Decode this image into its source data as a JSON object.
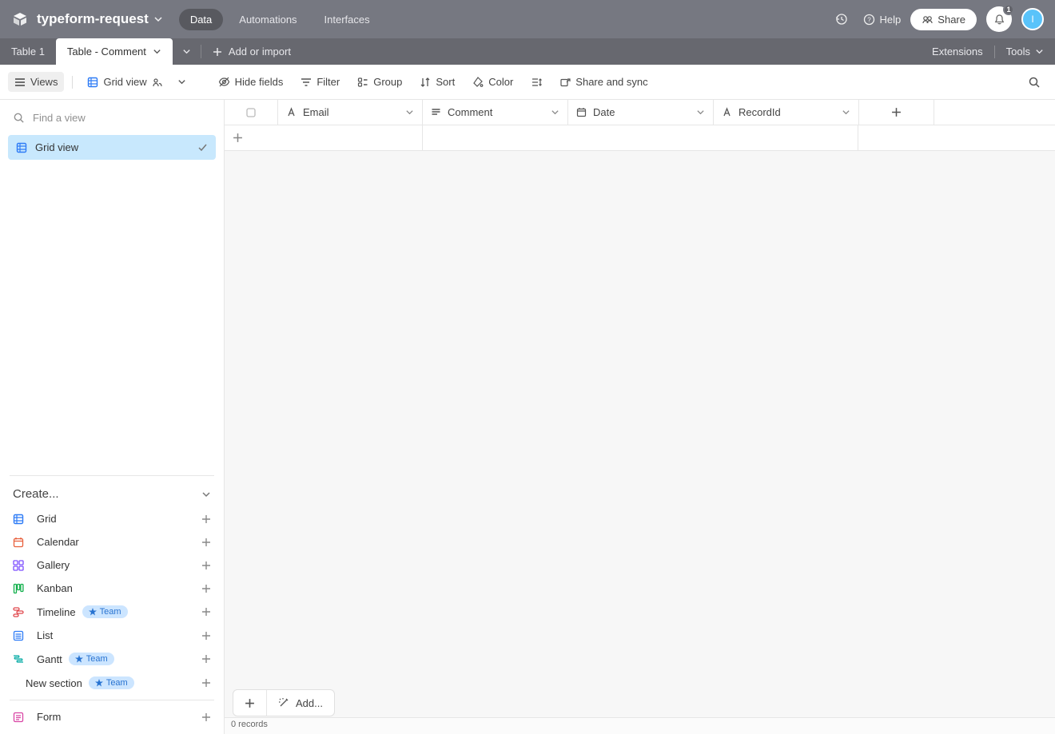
{
  "topbar": {
    "base_name": "typeform-request",
    "nav": {
      "data": "Data",
      "automations": "Automations",
      "interfaces": "Interfaces"
    },
    "help": "Help",
    "share": "Share",
    "notification_count": "1",
    "avatar_initial": "I"
  },
  "tabs": {
    "items": [
      {
        "label": "Table 1",
        "active": false
      },
      {
        "label": "Table - Comment",
        "active": true
      }
    ],
    "add_import": "Add or import",
    "extensions": "Extensions",
    "tools": "Tools"
  },
  "toolbar": {
    "views": "Views",
    "grid_view": "Grid view",
    "hide_fields": "Hide fields",
    "filter": "Filter",
    "group": "Group",
    "sort": "Sort",
    "color": "Color",
    "share_sync": "Share and sync"
  },
  "sidebar": {
    "search_placeholder": "Find a view",
    "views": [
      {
        "label": "Grid view",
        "active": true
      }
    ],
    "create_header": "Create...",
    "create_items": [
      {
        "label": "Grid",
        "icon": "grid",
        "color": "#2e7cf6",
        "team": false
      },
      {
        "label": "Calendar",
        "icon": "calendar",
        "color": "#e8603c",
        "team": false
      },
      {
        "label": "Gallery",
        "icon": "gallery",
        "color": "#7c4dff",
        "team": false
      },
      {
        "label": "Kanban",
        "icon": "kanban",
        "color": "#11af4b",
        "team": false
      },
      {
        "label": "Timeline",
        "icon": "timeline",
        "color": "#e0464b",
        "team": true
      },
      {
        "label": "List",
        "icon": "list",
        "color": "#2e7cf6",
        "team": false
      },
      {
        "label": "Gantt",
        "icon": "gantt",
        "color": "#01aaa4",
        "team": true
      },
      {
        "label": "New section",
        "icon": "none",
        "color": "#555",
        "team": true
      }
    ],
    "team_badge": "Team",
    "form": "Form"
  },
  "grid": {
    "columns": [
      {
        "label": "Email",
        "type": "text"
      },
      {
        "label": "Comment",
        "type": "longtext"
      },
      {
        "label": "Date",
        "type": "date"
      },
      {
        "label": "RecordId",
        "type": "text"
      }
    ],
    "add_label": "Add...",
    "record_count": "0 records"
  },
  "colors": {
    "topbar_bg": "#767881",
    "tabbar_bg": "#67686f",
    "active_view_bg": "#c8e8fd",
    "avatar_bg": "#59c3fa",
    "team_badge_bg": "#cce5ff",
    "team_badge_fg": "#2873d1"
  }
}
